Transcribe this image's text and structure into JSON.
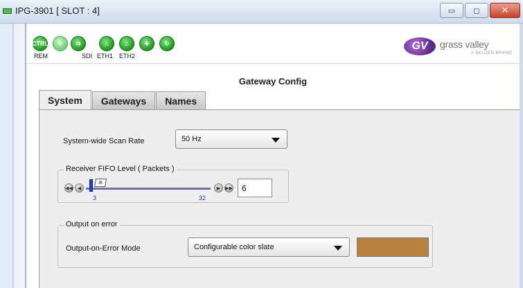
{
  "window": {
    "title": "IPG-3901 [ SLOT : 4]",
    "buttons": {
      "minimize": "▭",
      "maximize": "◻",
      "close": "✕"
    }
  },
  "header": {
    "icons": [
      {
        "name": "ctrl-icon",
        "glyph": "CTRL",
        "label": "REM"
      },
      {
        "name": "link-icon",
        "glyph": "✣",
        "label": ""
      },
      {
        "name": "sdi-icon",
        "glyph": "⇉",
        "label": "SDI"
      },
      {
        "name": "eth1-icon",
        "glyph": "⌂",
        "label": "ETH1"
      },
      {
        "name": "eth2-icon",
        "glyph": "⌂",
        "label": "ETH2"
      },
      {
        "name": "add-icon",
        "glyph": "✚",
        "label": ""
      },
      {
        "name": "refresh-icon",
        "glyph": "↻",
        "label": ""
      }
    ],
    "logo": {
      "mark": "GV",
      "name": "grass valley",
      "sub": "A BELDEN BRAND"
    }
  },
  "panel": {
    "title": "Gateway Config",
    "tabs": [
      {
        "label": "System",
        "active": true
      },
      {
        "label": "Gateways",
        "active": false
      },
      {
        "label": "Names",
        "active": false
      }
    ]
  },
  "system": {
    "scan_rate_label": "System-wide Scan Rate",
    "scan_rate_value": "50 Hz",
    "fifo_group_title": "Receiver FIFO Level ( Packets )",
    "fifo": {
      "min": "3",
      "max": "32",
      "value": "6"
    },
    "error_group_title": "Output on error",
    "error_mode_label": "Output-on-Error Mode",
    "error_mode_value": "Configurable color slate",
    "slate_color": "#b8803f"
  },
  "colors": {
    "accent_green": "#1f9a1f",
    "slider_thumb": "#1e44c9",
    "close_button": "#c5432b"
  }
}
